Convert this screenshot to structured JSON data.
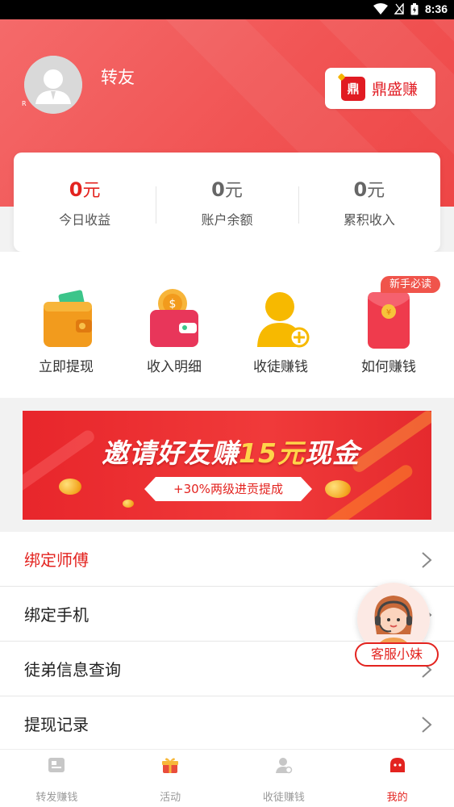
{
  "status_bar": {
    "time": "8:36"
  },
  "profile": {
    "username": "转友",
    "avatar_badge": "R"
  },
  "brand_button": {
    "logo_text": "鼎",
    "label": "鼎盛赚"
  },
  "earnings": [
    {
      "value": "0",
      "unit": "元",
      "label": "今日收益"
    },
    {
      "value": "0",
      "unit": "元",
      "label": "账户余额"
    },
    {
      "value": "0",
      "unit": "元",
      "label": "累积收入"
    }
  ],
  "quick_actions": [
    {
      "label": "立即提现",
      "icon": "wallet-icon"
    },
    {
      "label": "收入明细",
      "icon": "coin-purse-icon"
    },
    {
      "label": "收徒赚钱",
      "icon": "add-user-icon"
    },
    {
      "label": "如何赚钱",
      "icon": "red-envelope-icon",
      "badge": "新手必读"
    }
  ],
  "banner": {
    "title_part1": "邀请好友赚",
    "title_part2": "15元",
    "title_part3": "现金",
    "subtitle": "+30%两级进贡提成"
  },
  "menu": [
    {
      "label": "绑定师傅",
      "highlight": true
    },
    {
      "label": "绑定手机",
      "highlight": false
    },
    {
      "label": "徒弟信息查询",
      "highlight": false
    },
    {
      "label": "提现记录",
      "highlight": false
    }
  ],
  "customer_service": {
    "label": "客服小妹"
  },
  "tabbar": [
    {
      "label": "转发赚钱",
      "icon": "article-icon",
      "active": false
    },
    {
      "label": "活动",
      "icon": "gift-icon",
      "active": false
    },
    {
      "label": "收徒赚钱",
      "icon": "user-icon",
      "active": false
    },
    {
      "label": "我的",
      "icon": "mine-icon",
      "active": true
    }
  ],
  "colors": {
    "primary": "#e3231f",
    "header": "#f15454",
    "gold": "#ffd54a",
    "text_muted": "#999999"
  }
}
